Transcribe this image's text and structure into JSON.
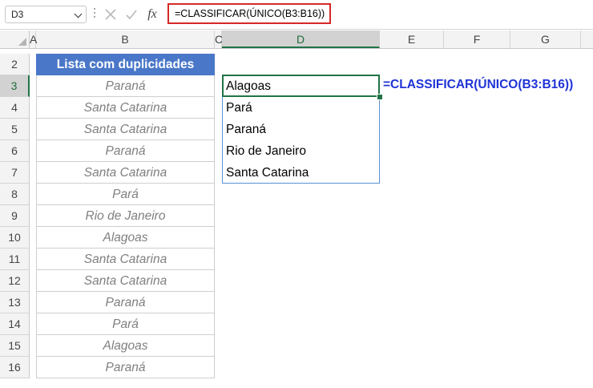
{
  "name_box": {
    "value": "D3"
  },
  "formula_bar": {
    "formula": "=CLASSIFICAR(ÚNICO(B3:B16))",
    "fx_label": "fx"
  },
  "columns": [
    "A",
    "B",
    "C",
    "D",
    "E",
    "F",
    "G"
  ],
  "rows": [
    "2",
    "3",
    "4",
    "5",
    "6",
    "7",
    "8",
    "9",
    "10",
    "11",
    "12",
    "13",
    "14",
    "15",
    "16"
  ],
  "selected": {
    "column": "D",
    "row": "3"
  },
  "sheet": {
    "header_b2": "Lista com duplicidades",
    "list_b": [
      "Paraná",
      "Santa Catarina",
      "Santa Catarina",
      "Paraná",
      "Santa Catarina",
      "Pará",
      "Rio de Janeiro",
      "Alagoas",
      "Santa Catarina",
      "Santa Catarina",
      "Paraná",
      "Pará",
      "Alagoas",
      "Paraná"
    ],
    "result_d": [
      "Alagoas",
      "Pará",
      "Paraná",
      "Rio de Janeiro",
      "Santa Catarina"
    ],
    "annotation_e3": "=CLASSIFICAR(ÚNICO(B3:B16))"
  },
  "colors": {
    "header_fill": "#4a77c8",
    "annotation": "#1f33d6",
    "selection": "#217346",
    "formula_highlight": "#d62828"
  }
}
